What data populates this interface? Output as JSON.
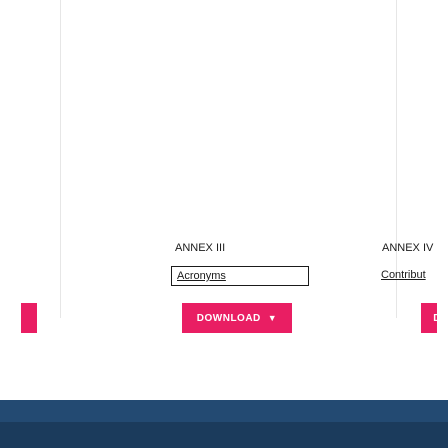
{
  "annex_columns": [
    {
      "heading": "ANNEX III",
      "link_text": "Acronyms",
      "download_label": "DOWNLOAD",
      "caret": "▼"
    },
    {
      "heading": "ANNEX IV",
      "link_text": "Contribut",
      "download_label": "D"
    }
  ],
  "colors": {
    "accent": "#e91e63",
    "footer": "#1b3b5c",
    "footer_band": "#234a72",
    "border": "#1a1a1a"
  }
}
